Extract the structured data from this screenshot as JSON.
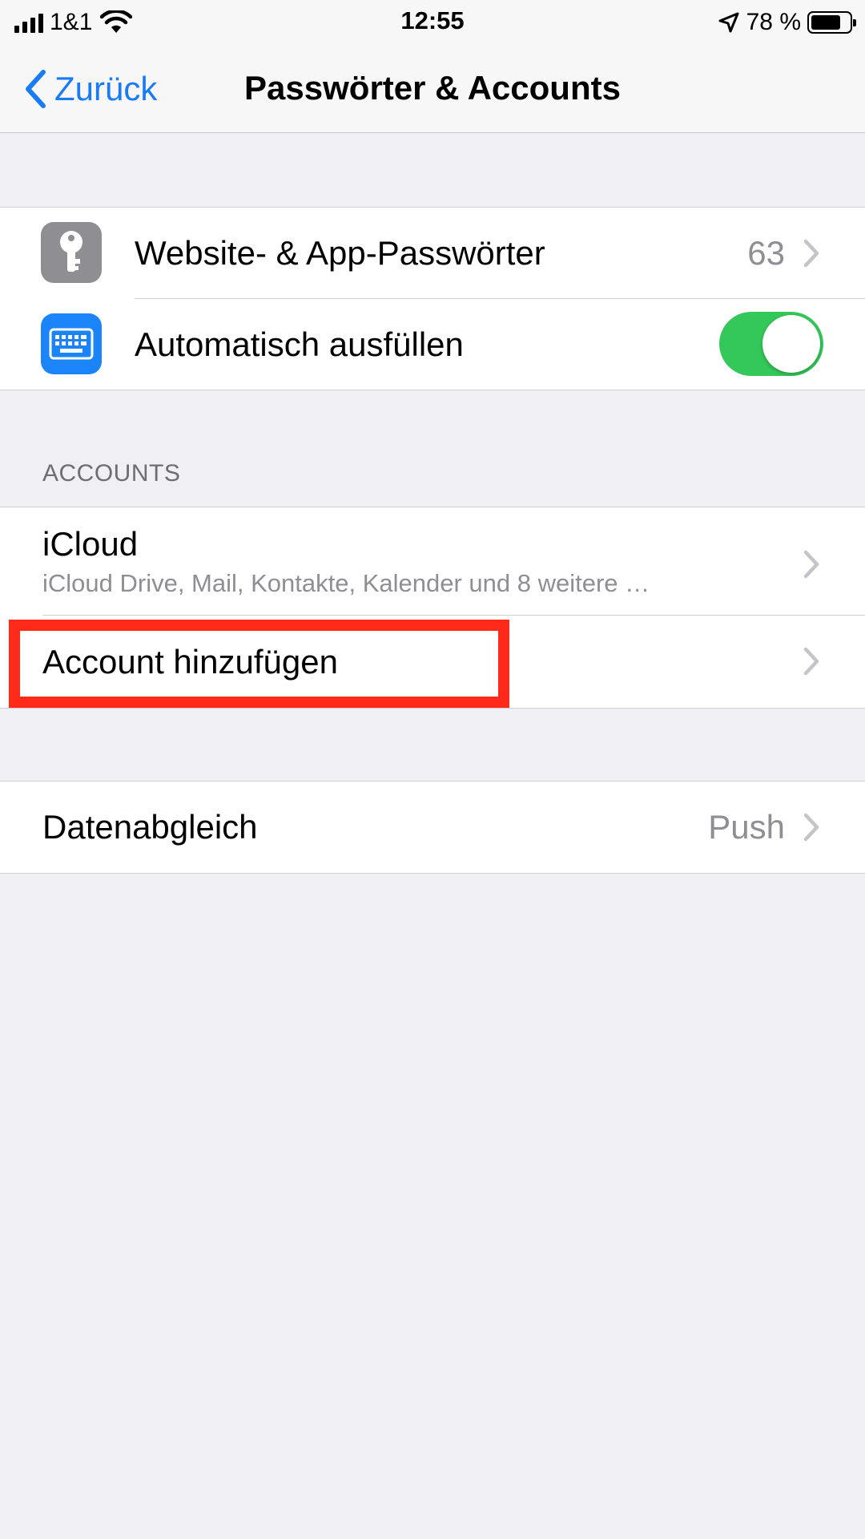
{
  "status_bar": {
    "carrier": "1&1",
    "time": "12:55",
    "battery_percent": "78 %",
    "battery_level": 0.78
  },
  "nav": {
    "back_label": "Zurück",
    "title": "Passwörter & Accounts"
  },
  "passwords_group": {
    "website_passwords": {
      "label": "Website- & App-Passwörter",
      "value": "63",
      "icon": "key-icon"
    },
    "autofill": {
      "label": "Automatisch ausfüllen",
      "toggle_on": true,
      "icon": "keyboard-icon"
    }
  },
  "accounts_section": {
    "header": "ACCOUNTS",
    "icloud": {
      "label": "iCloud",
      "subtitle": "iCloud Drive, Mail, Kontakte, Kalender und 8 weitere …"
    },
    "add_account": {
      "label": "Account hinzufügen"
    }
  },
  "fetch_group": {
    "data_sync": {
      "label": "Datenabgleich",
      "value": "Push"
    }
  },
  "colors": {
    "accent": "#1a7cf5",
    "toggle_on": "#34c759",
    "highlight": "#ff2a1a",
    "background": "#efeff4"
  }
}
